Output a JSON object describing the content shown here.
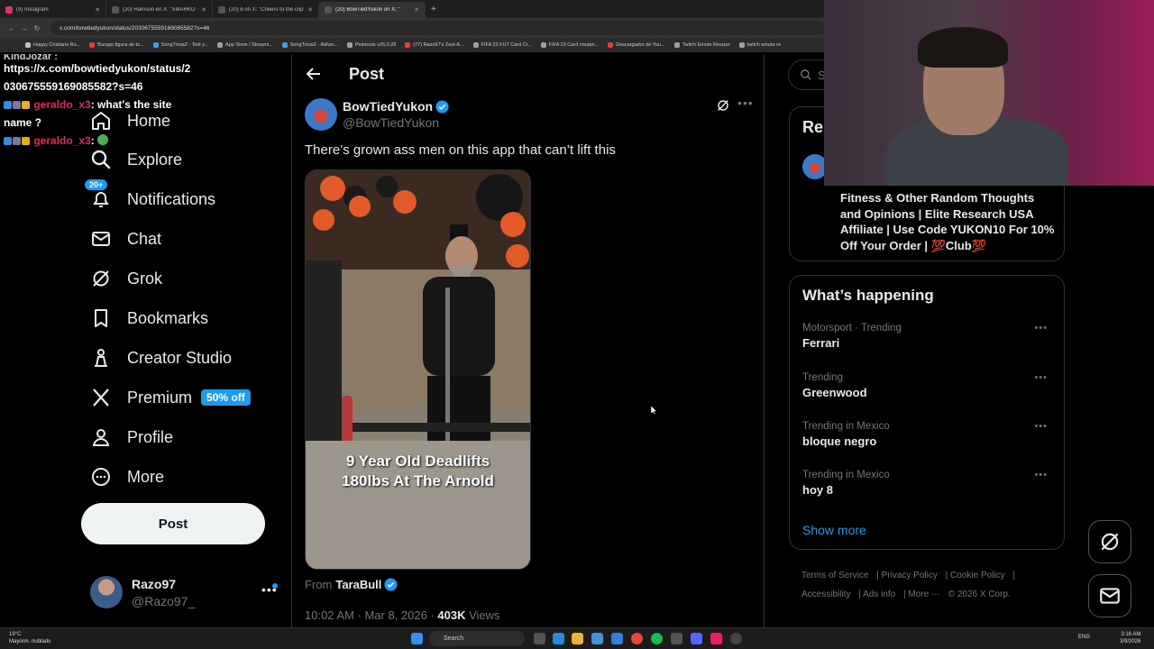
{
  "browser": {
    "tabs": [
      {
        "title": "(9) Instagram",
        "color": "#e1306c",
        "active": false
      },
      {
        "title": "(20) Harrison en X: \"SMARKO",
        "color": "#888888",
        "active": false
      },
      {
        "title": "(20) 8 on X: \"Cheers to the cop",
        "color": "#888888",
        "active": false
      },
      {
        "title": "(20) BowTiedYukon on X: \"",
        "color": "#888888",
        "active": true
      }
    ],
    "url": "x.com/bowtiedyukon/status/2030675559169085582?s=46",
    "bookmarks": [
      {
        "label": "Happy Cristiano Ro...",
        "color": "#c0c0c0"
      },
      {
        "label": "Burago figura de to...",
        "color": "#e04040"
      },
      {
        "label": "SongTrivia2 - Test y...",
        "color": "#40a0e0"
      },
      {
        "label": "App Store / Streami...",
        "color": "#a0a0a0"
      },
      {
        "label": "SongTrivia2 - Adivin...",
        "color": "#40a0e0"
      },
      {
        "label": "Peletools v26.0.28",
        "color": "#a0a0a0"
      },
      {
        "label": "(77) Razo97's Zest-A...",
        "color": "#e04040"
      },
      {
        "label": "FIFA 23 FUT Card Cr...",
        "color": "#a0a0a0"
      },
      {
        "label": "FIFA 23 Card creator...",
        "color": "#a0a0a0"
      },
      {
        "label": "Descargador de You...",
        "color": "#e04040"
      },
      {
        "label": "Twitch Emote Resizer",
        "color": "#a0a0a0"
      },
      {
        "label": "twitch emote re",
        "color": "#a0a0a0"
      }
    ]
  },
  "chat": {
    "top_user": "KingJozar :",
    "link": "https://x.com/bowtiedyukon/status/2030675559169085582?s=46",
    "msg1_user": "geraldo_x3",
    "msg1_text": ": what's the site name ?",
    "msg2_user": "geraldo_x3",
    "msg2_text": ":"
  },
  "nav": {
    "home": "Home",
    "explore": "Explore",
    "notifications": "Notifications",
    "notifications_badge": "20+",
    "chat": "Chat",
    "grok": "Grok",
    "bookmarks": "Bookmarks",
    "creator_studio": "Creator Studio",
    "premium": "Premium",
    "premium_badge": "50% off",
    "profile": "Profile",
    "more": "More",
    "post_button": "Post"
  },
  "account": {
    "name": "Razo97",
    "handle": "@Razo97_"
  },
  "post": {
    "header": "Post",
    "author_name": "BowTiedYukon",
    "author_handle": "@BowTiedYukon",
    "text": "There’s grown ass men on this app that can’t lift this",
    "media_caption": "9 Year Old Deadlifts 180lbs At The Arnold",
    "from_label": "From",
    "from_name": "TaraBull",
    "time": "10:02 AM · Mar 8, 2026 · ",
    "views_count": "403K",
    "views_label": " Views"
  },
  "sidebar": {
    "search_placeholder": "Se",
    "relevant_title": "Rel",
    "relevant_bio": "Fitness & Other Random Thoughts and Opinions | Elite Research USA Affiliate | Use Code YUKON10 For 10% Off Your Order | 💯Club💯",
    "happening_title": "What’s happening",
    "trends": [
      {
        "meta": "Motorsport · Trending",
        "name": "Ferrari"
      },
      {
        "meta": "Trending",
        "name": "Greenwood"
      },
      {
        "meta": "Trending in Mexico",
        "name": "bloque negro"
      },
      {
        "meta": "Trending in Mexico",
        "name": "hoy 8"
      }
    ],
    "show_more": "Show more",
    "footer": {
      "terms": "Terms of Service",
      "privacy": "Privacy Policy",
      "cookie": "Cookie Policy",
      "accessibility": "Accessibility",
      "ads": "Ads info",
      "more": "More ···",
      "copyright": "© 2026 X Corp."
    }
  },
  "taskbar": {
    "temp": "19°C",
    "weather": "Mayorm. nublado",
    "search": "Search",
    "lang": "ENG",
    "time": "3:16 AM",
    "date": "3/9/2026"
  },
  "colors": {
    "accent": "#1d9bf0",
    "background": "#000000",
    "chat_user": "#e0245e"
  }
}
